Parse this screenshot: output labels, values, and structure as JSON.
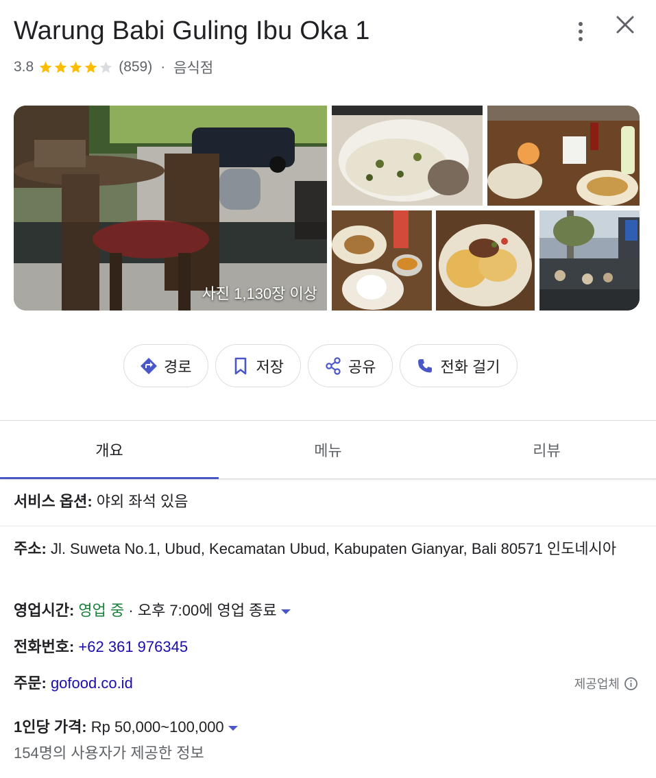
{
  "place": {
    "name": "Warung Babi Guling Ibu Oka 1",
    "rating": "3.8",
    "stars": 3.8,
    "review_count": "(859)",
    "separator": "·",
    "category": "음식점"
  },
  "photos": {
    "count_label": "사진 1,130장 이상"
  },
  "actions": {
    "directions": "경로",
    "save": "저장",
    "share": "공유",
    "call": "전화 걸기"
  },
  "tabs": [
    {
      "label": "개요",
      "active": true
    },
    {
      "label": "메뉴",
      "active": false
    },
    {
      "label": "리뷰",
      "active": false
    }
  ],
  "details": {
    "service_label": "서비스 옵션:",
    "service_value": "야외 좌석 있음",
    "address_label": "주소:",
    "address_value": "Jl. Suweta No.1, Ubud, Kecamatan Ubud, Kabupaten Gianyar, Bali 80571 인도네시아",
    "hours_label": "영업시간:",
    "hours_status": "영업 중",
    "hours_detail": "· 오후 7:00에 영업 종료",
    "phone_label": "전화번호:",
    "phone_value": "+62 361 976345",
    "order_label": "주문:",
    "order_value": "gofood.co.id",
    "provider_label": "제공업체",
    "price_label": "1인당 가격:",
    "price_value": "Rp 50,000~100,000",
    "price_note": "154명의 사용자가 제공한 정보"
  },
  "colors": {
    "star": "#fbbc04",
    "star_empty": "#dadce0",
    "accent": "#4a58c7",
    "open": "#188038",
    "link": "#1a0dab"
  },
  "icons": {
    "more": "more-vert-icon",
    "close": "close-icon",
    "directions": "directions-icon",
    "save": "bookmark-icon",
    "share": "share-icon",
    "call": "phone-icon",
    "info": "info-icon"
  }
}
